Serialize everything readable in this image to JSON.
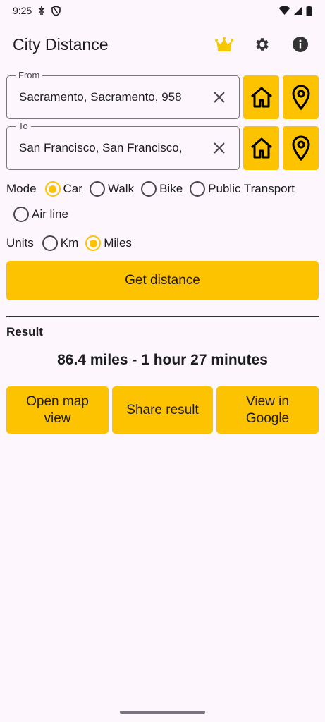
{
  "status": {
    "time": "9:25",
    "icons": [
      "sync-icon",
      "shield-icon",
      "wifi-icon",
      "signal-icon",
      "battery-icon"
    ]
  },
  "app": {
    "title": "City Distance",
    "accent": "#fec300",
    "actions": [
      "crown-icon",
      "settings-icon",
      "info-icon"
    ]
  },
  "from": {
    "label": "From",
    "value": "Sacramento, Sacramento, 958"
  },
  "to": {
    "label": "To",
    "value": "San Francisco, San Francisco,"
  },
  "mode": {
    "label": "Mode",
    "selected": "Car",
    "options": [
      "Car",
      "Walk",
      "Bike",
      "Public Transport",
      "Air line"
    ]
  },
  "units": {
    "label": "Units",
    "selected": "Miles",
    "options": [
      "Km",
      "Miles"
    ]
  },
  "get_distance_label": "Get distance",
  "result": {
    "heading": "Result",
    "text": "86.4 miles - 1 hour 27 minutes"
  },
  "actions": {
    "open_map": "Open map view",
    "share": "Share result",
    "view_google": "View in Google"
  }
}
